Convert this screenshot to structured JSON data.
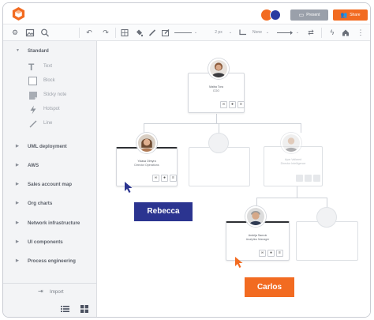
{
  "header": {
    "logo_icon": "lucid-logo-icon",
    "present_label": "Present",
    "share_label": "Share",
    "brand_color": "#f26b21",
    "collaborator_colors": [
      "#f26b21",
      "#2a3aa0"
    ]
  },
  "toolbar": {
    "line_width": "2 px",
    "arrow_none": "None",
    "icons": [
      "settings-icon",
      "image-icon",
      "search-icon",
      "undo-icon",
      "redo-icon",
      "frame-icon",
      "fill-icon",
      "pen-icon",
      "style-icon",
      "line-style-icon",
      "corner-icon",
      "arrow-start-icon",
      "arrow-end-icon",
      "swap-icon",
      "lightning-icon",
      "home-icon"
    ]
  },
  "sidebar": {
    "standard_section": "Standard",
    "shapes": [
      {
        "icon": "text-icon",
        "label": "Text"
      },
      {
        "icon": "block-icon",
        "label": "Block"
      },
      {
        "icon": "sticky-note-icon",
        "label": "Sticky note"
      },
      {
        "icon": "hotspot-icon",
        "label": "Hotspot"
      },
      {
        "icon": "line-icon",
        "label": "Line"
      }
    ],
    "sections": [
      "UML deployment",
      "AWS",
      "Sales account map",
      "Org charts",
      "Network infrastructure",
      "UI components",
      "Process engineering"
    ],
    "import_label": "Import"
  },
  "canvas": {
    "ceo": {
      "name": "Maiba Tora",
      "role": "COO"
    },
    "rebecca_card": {
      "name": "Yolasa Olmyra",
      "role": "Director Operations"
    },
    "faint_card": {
      "name": "Ayar Vallared",
      "role": "Director Intelligence"
    },
    "carlos_card": {
      "name": "Andrija Sanrok",
      "role": "Analytics Manager"
    },
    "tag_rebecca": "Rebecca",
    "tag_carlos": "Carlos",
    "colors": {
      "rebecca_tag": "#2b3490",
      "carlos_tag": "#f26b21"
    }
  }
}
